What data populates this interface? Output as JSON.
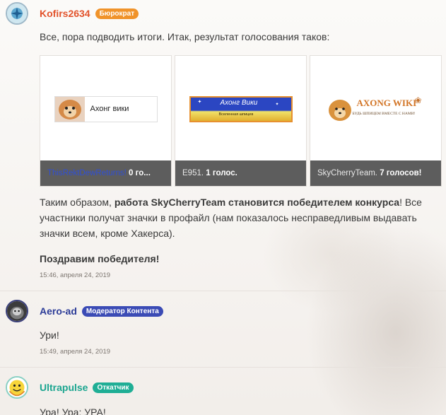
{
  "posts": [
    {
      "user": "Kofirs2634",
      "badge": "Бюрократ",
      "text": "Все, пора подводить итоги. Итак, результат голосования таков:",
      "gallery": [
        {
          "image_text": "Ахонг вики",
          "author": "ThisRektDewReturns!",
          "votes": "0 го..."
        },
        {
          "image_text": "Ахонг Вики",
          "image_subtext": "Вселенная шпицев",
          "author": "E951.",
          "votes": "1 голос."
        },
        {
          "image_text": "AXONG WIKI",
          "image_subtext": "БУДЬ ШПИЦЕМ ВМЕСТЕ С НАМИ!",
          "author": "SkyCherryTeam.",
          "votes": "7 голосов!"
        }
      ],
      "para1_a": "Таким образом, ",
      "para1_b": "работа SkyCherryTeam становится победителем конкурса",
      "para1_c": "! Все участники получат значки в профайл (нам показалось несправедливым выдавать значки всем, кроме Хакерса).",
      "para2": "Поздравим победителя!",
      "timestamp": "15:46, апреля 24, 2019"
    },
    {
      "user": "Aero-ad",
      "badge": "Модератор Контента",
      "text": "Ури!",
      "timestamp": "15:49, апреля 24, 2019"
    },
    {
      "user": "Ultrapulse",
      "badge": "Откатчик",
      "text": "Ура! Ура: УРА!"
    }
  ],
  "colors": {
    "kofirs_name": "#e2532b",
    "bureaucrat_badge": "#f0932a",
    "aero_name": "#2c3c98",
    "moderator_badge": "#3b4bb5",
    "ultrapulse_name": "#1aa58f",
    "rollback_badge": "#1fae95"
  }
}
